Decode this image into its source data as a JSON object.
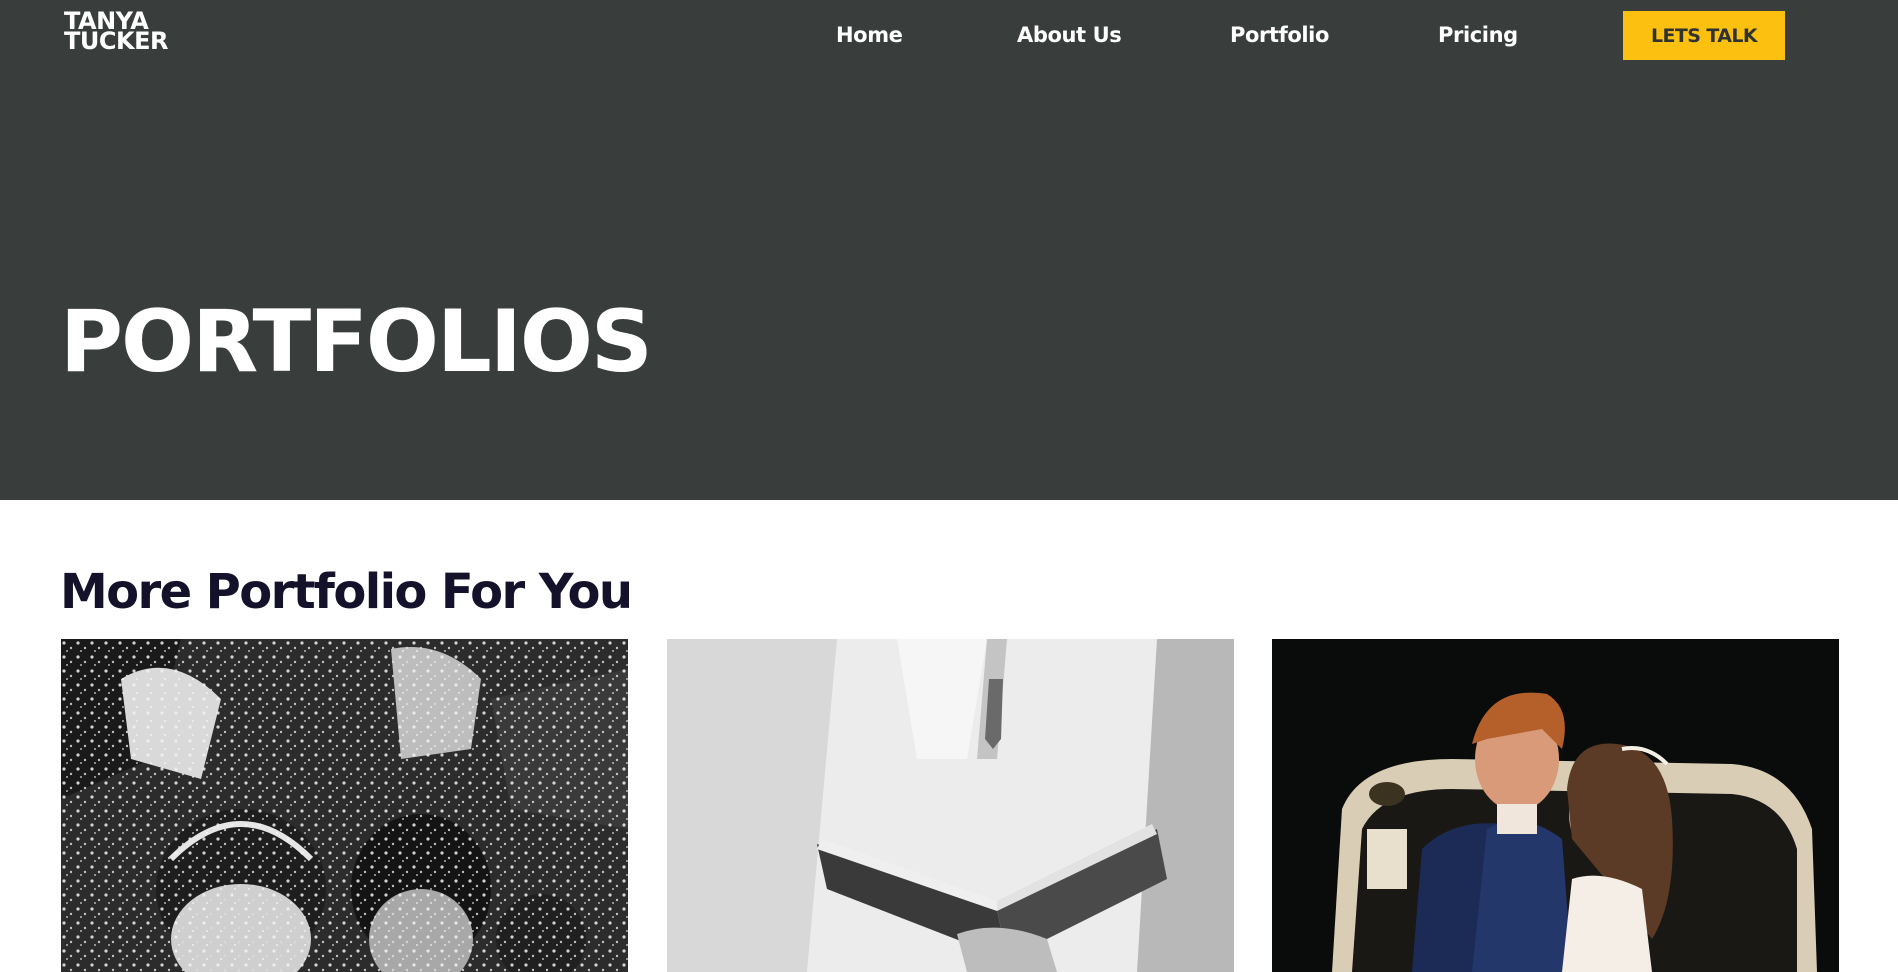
{
  "brand": {
    "line1": "TANYA",
    "line2": "TUCKER"
  },
  "nav": {
    "items": [
      {
        "label": "Home"
      },
      {
        "label": "About Us"
      },
      {
        "label": "Portfolio"
      },
      {
        "label": "Pricing"
      }
    ],
    "cta_label": "LETS TALK"
  },
  "hero": {
    "title": "PORTFOLIOS"
  },
  "section": {
    "title": "More Portfolio For You"
  },
  "colors": {
    "hero_bg": "#393e3d",
    "cta_bg": "#fcc010",
    "heading": "#14112b"
  },
  "cards": [
    {
      "image": "confetti-couple-photo"
    },
    {
      "image": "officiant-holding-book-photo"
    },
    {
      "image": "couple-kissing-at-night-photo"
    }
  ]
}
